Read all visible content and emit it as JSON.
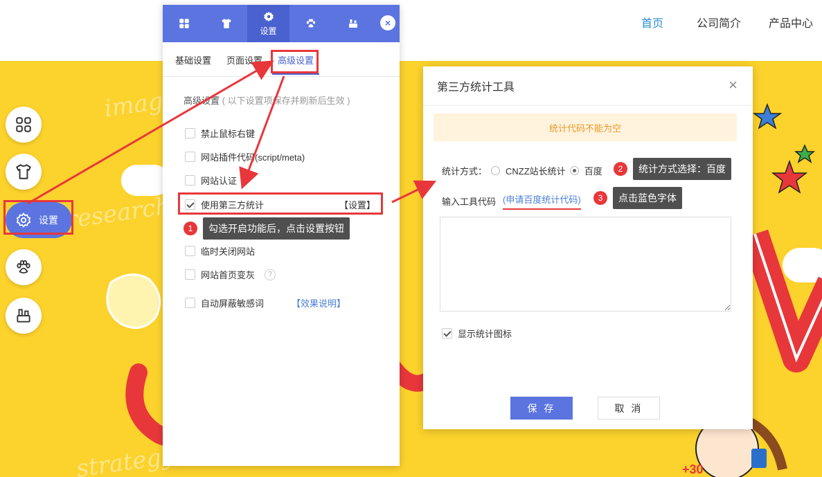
{
  "nav": {
    "items": [
      "首页",
      "公司简介",
      "产品中心"
    ],
    "active_index": 0,
    "active_color": "#2a8fd0"
  },
  "banner": {
    "bg_color": "#fcd22c",
    "decor_words": [
      "imagina",
      "research",
      "strategy"
    ]
  },
  "sidebar": {
    "items": [
      {
        "icon": "grid-icon"
      },
      {
        "icon": "tshirt-icon"
      },
      {
        "icon": "gear-icon",
        "label": "设置",
        "active": true
      },
      {
        "icon": "paw-icon"
      },
      {
        "icon": "toolbox-icon"
      }
    ]
  },
  "panel": {
    "tabs": [
      {
        "icon": "grid-icon"
      },
      {
        "icon": "tshirt-icon"
      },
      {
        "icon": "gear-icon",
        "label": "设置",
        "active": true
      },
      {
        "icon": "paw-icon"
      },
      {
        "icon": "toolbox-icon"
      }
    ],
    "close_label": "×",
    "sub_tabs": [
      "基础设置",
      "页面设置",
      "高级设置"
    ],
    "active_sub_tab": 2,
    "section_title": "高级设置",
    "section_hint": "( 以下设置项保存并刷新后生效 )",
    "options": [
      {
        "label": "禁止鼠标右键",
        "checked": false
      },
      {
        "label": "网站插件代码(script/meta)",
        "checked": false
      },
      {
        "label": "网站认证",
        "checked": false
      },
      {
        "label": "使用第三方统计",
        "checked": true,
        "action": "【设置】"
      },
      {
        "label": "临时关闭网站",
        "checked": false
      },
      {
        "label": "网站首页变灰",
        "checked": false,
        "help": "?"
      },
      {
        "label": "自动屏蔽敏感词",
        "checked": false,
        "link": "【效果说明】"
      }
    ]
  },
  "dialog": {
    "title": "第三方统计工具",
    "close_label": "×",
    "warning": "统计代码不能为空",
    "method_label": "统计方式：",
    "method_options": [
      "CNZZ站长统计",
      "百度"
    ],
    "method_selected": 1,
    "code_label": "输入工具代码",
    "code_link": "(申请百度统计代码)",
    "code_value": "",
    "show_icon_label": "显示统计图标",
    "show_icon_checked": true,
    "save_label": "保 存",
    "cancel_label": "取 消"
  },
  "callouts": [
    {
      "num": "1",
      "text": "勾选开启功能后，点击设置按钮"
    },
    {
      "num": "2",
      "text": "统计方式选择：百度"
    },
    {
      "num": "3",
      "text": "点击蓝色字体"
    }
  ],
  "colors": {
    "accent": "#5b74e0",
    "highlight_red": "#e8373a",
    "link": "#4a7fd6",
    "warning_text": "#e89b2a"
  }
}
